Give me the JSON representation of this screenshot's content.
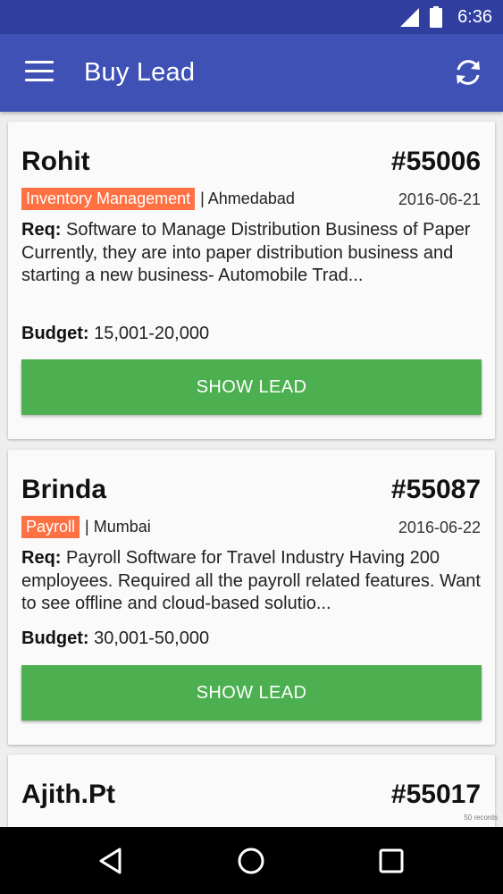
{
  "status_bar": {
    "time": "6:36",
    "icons": [
      "signal-icon",
      "battery-icon"
    ]
  },
  "app_bar": {
    "title": "Buy Lead",
    "menu_icon": "menu-icon",
    "refresh_icon": "refresh-icon"
  },
  "leads": [
    {
      "name": "Rohit",
      "id": "#55006",
      "category": "Inventory Management",
      "city": "| Ahmedabad",
      "date": "2016-06-21",
      "req_label": "Req:",
      "req_text": " Software to Manage Distribution Business of Paper Currently, they are into paper distribution business and starting a new business- Automobile Trad...",
      "budget_label": "Budget:",
      "budget_value": " 15,001-20,000",
      "button_label": "SHOW LEAD"
    },
    {
      "name": "Brinda",
      "id": "#55087",
      "category": "Payroll",
      "city": "| Mumbai",
      "date": "2016-06-22",
      "req_label": "Req:",
      "req_text": " Payroll Software for Travel Industry Having 200 employees. Required all the payroll related features. Want to see offline and cloud-based solutio...",
      "budget_label": "Budget:",
      "budget_value": " 30,001-50,000",
      "button_label": "SHOW LEAD"
    },
    {
      "name": "Ajith.Pt",
      "id": "#55017"
    }
  ],
  "records_label": "50 records",
  "colors": {
    "status_bar": "#303f9f",
    "app_bar": "#3f51b5",
    "tag": "#ff7043",
    "button": "#4caf50"
  },
  "nav_bar": {
    "buttons": [
      "back-icon",
      "home-icon",
      "recents-icon"
    ]
  }
}
